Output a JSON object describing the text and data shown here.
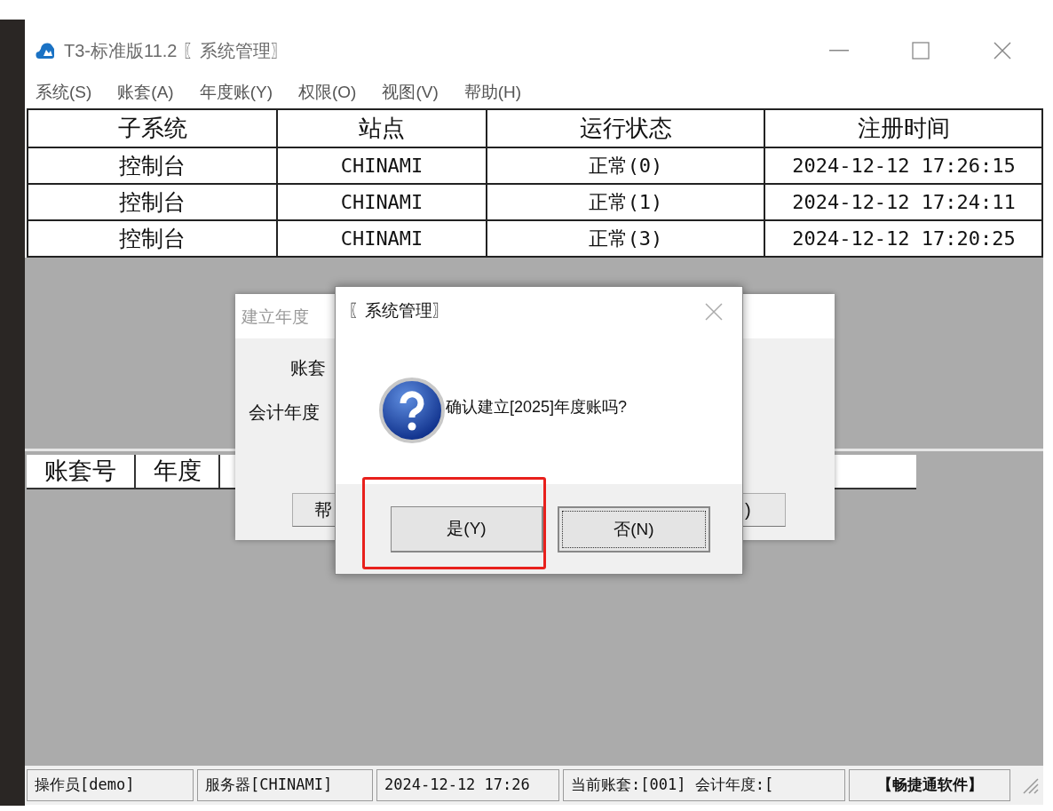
{
  "window": {
    "title": "T3-标准版11.2 〖系统管理〗"
  },
  "menu": [
    "系统(S)",
    "账套(A)",
    "年度账(Y)",
    "权限(O)",
    "视图(V)",
    "帮助(H)"
  ],
  "process_table": {
    "columns": [
      "子系统",
      "站点",
      "运行状态",
      "注册时间"
    ],
    "rows": [
      [
        "控制台",
        "CHINAMI",
        "正常(0)",
        "2024-12-12 17:26:15"
      ],
      [
        "控制台",
        "CHINAMI",
        "正常(1)",
        "2024-12-12 17:24:11"
      ],
      [
        "控制台",
        "CHINAMI",
        "正常(3)",
        "2024-12-12 17:20:25"
      ]
    ]
  },
  "account_table": {
    "columns": [
      "账套号",
      "年度"
    ]
  },
  "back_dialog": {
    "title": "建立年度",
    "labels": [
      "账套",
      "会计年度"
    ],
    "buttons": [
      "帮",
      ")"
    ]
  },
  "confirm_dialog": {
    "title": "〖系统管理〗",
    "message": "确认建立[2025]年度账吗?",
    "buttons": [
      {
        "label": "是(Y)",
        "focused": false,
        "highlighted": true
      },
      {
        "label": "否(N)",
        "focused": true,
        "highlighted": false
      }
    ]
  },
  "status_bar": [
    "操作员[demo]",
    "服务器[CHINAMI]",
    "2024-12-12 17:26",
    "当前账套:[001] 会计年度:[",
    "【畅捷通软件】"
  ]
}
